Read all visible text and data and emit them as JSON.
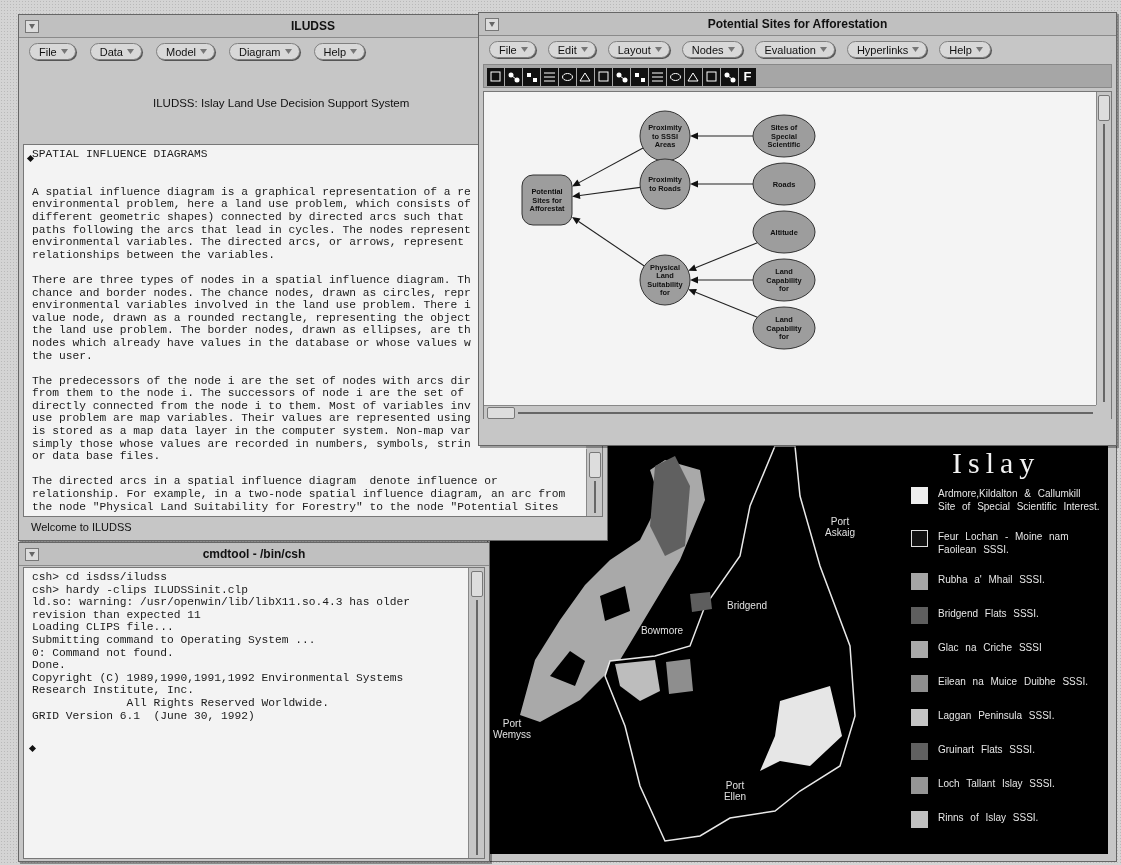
{
  "main_window": {
    "title": "ILUDSS",
    "menus": [
      "File",
      "Data",
      "Model",
      "Diagram",
      "Help"
    ],
    "banner": "ILUDSS: Islay Land Use Decision Support System",
    "help_text": {
      "heading": "SPATIAL INFLUENCE DIAGRAMS",
      "paragraphs": [
        [
          "A spatial influence diagram is a graphical representation of a re",
          "environmental problem, here a land use problem, which consists of",
          "different geometric shapes) connected by directed arcs such that",
          "paths following the arcs that lead in cycles. The nodes represent",
          "environmental variables. The directed arcs, or arrows, represent",
          "relationships between the variables."
        ],
        [
          "There are three types of nodes in a spatial influence diagram. Th",
          "chance and border nodes. The chance nodes, drawn as circles, repr",
          "environmental variables involved in the land use problem. There i",
          "value node, drawn as a rounded rectangle, representing the object",
          "the land use problem. The border nodes, drawn as ellipses, are th",
          "nodes which already have values in the database or whose values w",
          "the user."
        ],
        [
          "The predecessors of the node i are the set of nodes with arcs dir",
          "from them to the node i. The successors of node i are the set of",
          "directly connected from the node i to them. Most of variables inv",
          "use problem are map variables. Their values are represented using",
          "is stored as a map data layer in the computer system. Non-map var",
          "simply those whose values are recorded in numbers, symbols, strin",
          "or data base files."
        ],
        [
          "The directed arcs in a spatial influence diagram  denote influence or",
          "relationship. For example, in a two-node spatial influence diagram, an arc from",
          "the node \"Physical Land Suitability for Forestry\" to the node \"Potential Sites"
        ]
      ]
    },
    "status": "Welcome to ILUDSS"
  },
  "console_window": {
    "title": "cmdtool - /bin/csh",
    "lines": [
      "csh> cd isdss/iludss",
      "csh> hardy -clips ILUDSSinit.clp",
      "ld.so: warning: /usr/openwin/lib/libX11.so.4.3 has older",
      "revision than expected 11",
      "Loading CLIPS file...",
      "Submitting command to Operating System ...",
      "0: Command not found.",
      "Done.",
      "Copyright (C) 1989,1990,1991,1992 Environmental Systems",
      "Research Institute, Inc.",
      "              All Rights Reserved Worldwide.",
      "GRID Version 6.1  (June 30, 1992)"
    ]
  },
  "diagram_window": {
    "title": "Potential Sites for Afforestation",
    "menus": [
      "File",
      "Edit",
      "Layout",
      "Nodes",
      "Evaluation",
      "Hyperlinks",
      "Help"
    ],
    "toolbar_text_button": "F",
    "diagram": {
      "kind": "value",
      "lines": [
        "Potential",
        "Sites for",
        "Afforestat"
      ],
      "children": [
        {
          "kind": "chance",
          "lines": [
            "Proximity",
            "to SSSI",
            "Areas"
          ],
          "children": [
            {
              "kind": "border",
              "lines": [
                "Sites of",
                "Special",
                "Scientific"
              ]
            }
          ]
        },
        {
          "kind": "chance",
          "lines": [
            "Proximity",
            "to Roads"
          ],
          "children": [
            {
              "kind": "border",
              "lines": [
                "Roads"
              ]
            }
          ]
        },
        {
          "kind": "chance",
          "lines": [
            "Physical",
            "Land",
            "Suitability",
            "for"
          ],
          "children": [
            {
              "kind": "border",
              "lines": [
                "Altitude"
              ]
            },
            {
              "kind": "border",
              "lines": [
                "Land",
                "Capability",
                "for"
              ]
            },
            {
              "kind": "border",
              "lines": [
                "Land",
                "Capability",
                "for"
              ]
            }
          ]
        }
      ]
    }
  },
  "map_window": {
    "map_title": "Islay",
    "places": [
      {
        "lines": [
          "Port",
          "Askaig"
        ]
      },
      {
        "lines": [
          "Bridgend"
        ]
      },
      {
        "lines": [
          "Bowmore"
        ]
      },
      {
        "lines": [
          "Port",
          "Wemyss"
        ]
      },
      {
        "lines": [
          "Port",
          "Ellen"
        ]
      }
    ],
    "legend": [
      {
        "label": "Ardmore,Kildalton & Callumkill Site of Special Scientific Interest.",
        "color": "#eeeeee"
      },
      {
        "label": "Feur Lochan - Moine nam Faoilean SSSI.",
        "color": "#111111"
      },
      {
        "label": "Rubha a' Mhail SSSI.",
        "color": "#a5a5a5"
      },
      {
        "label": "Bridgend Flats SSSI.",
        "color": "#5e5e5e"
      },
      {
        "label": "Glac na Criche SSSI",
        "color": "#a9a9a9"
      },
      {
        "label": "Eilean na Muice Duibhe SSSI.",
        "color": "#8e8e8e"
      },
      {
        "label": "Laggan Peninsula SSSI.",
        "color": "#c4c4c4"
      },
      {
        "label": "Gruinart Flats SSSI.",
        "color": "#606060"
      },
      {
        "label": "Loch Tallant Islay SSSI.",
        "color": "#959595"
      },
      {
        "label": "Rinns of Islay SSSI.",
        "color": "#bfbfbf"
      }
    ]
  }
}
